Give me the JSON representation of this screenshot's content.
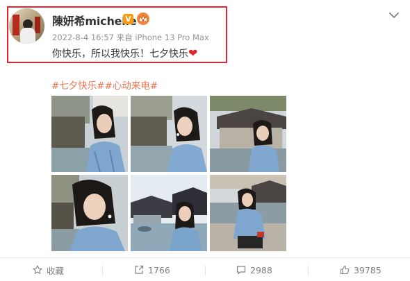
{
  "post": {
    "username": "陳妍希michelle",
    "vip_badge": "V",
    "timestamp": "2022-8-4 16:57",
    "source_prefix": "来自",
    "device": "iPhone 13 Pro Max",
    "text": "你快乐，所以我快乐！七夕快乐",
    "emoji": "heart-emoji",
    "hashtags": "#七夕快乐##心动来电#"
  },
  "actions": {
    "favorite_label": "收藏",
    "repost_count": "1766",
    "comment_count": "2988",
    "like_count": "39785"
  },
  "colors": {
    "highlight_border": "#e8232f",
    "hashtag": "#eb7350",
    "vip_badge": "#f59b12",
    "crown_badge": "#f3863b"
  }
}
